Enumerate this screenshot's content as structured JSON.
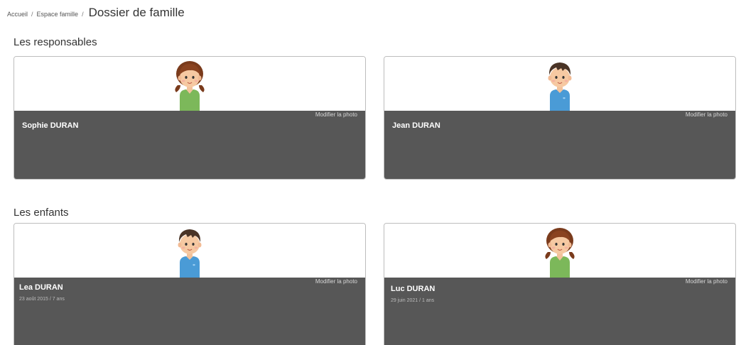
{
  "breadcrumb": {
    "home": "Accueil",
    "family_space": "Espace famille",
    "separator": "/",
    "current": "Dossier de famille"
  },
  "sections": {
    "responsables_title": "Les responsables",
    "enfants_title": "Les enfants"
  },
  "edit_photo_label": "Modifier la photo",
  "responsables": [
    {
      "name": "Sophie DURAN",
      "avatar": "girl-avatar-icon"
    },
    {
      "name": "Jean DURAN",
      "avatar": "boy-avatar-icon"
    }
  ],
  "enfants": [
    {
      "name": "Lea DURAN",
      "birth": "23 août 2015 / 7 ans",
      "avatar": "boy-avatar-icon"
    },
    {
      "name": "Luc DURAN",
      "birth": "29 juin 2021 / 1 ans",
      "avatar": "girl-avatar-icon"
    }
  ],
  "colors": {
    "card_info_bg": "#575757",
    "girl_shirt": "#7cb85a",
    "boy_shirt": "#4a9bd6",
    "hair": "#7a3b1c"
  }
}
